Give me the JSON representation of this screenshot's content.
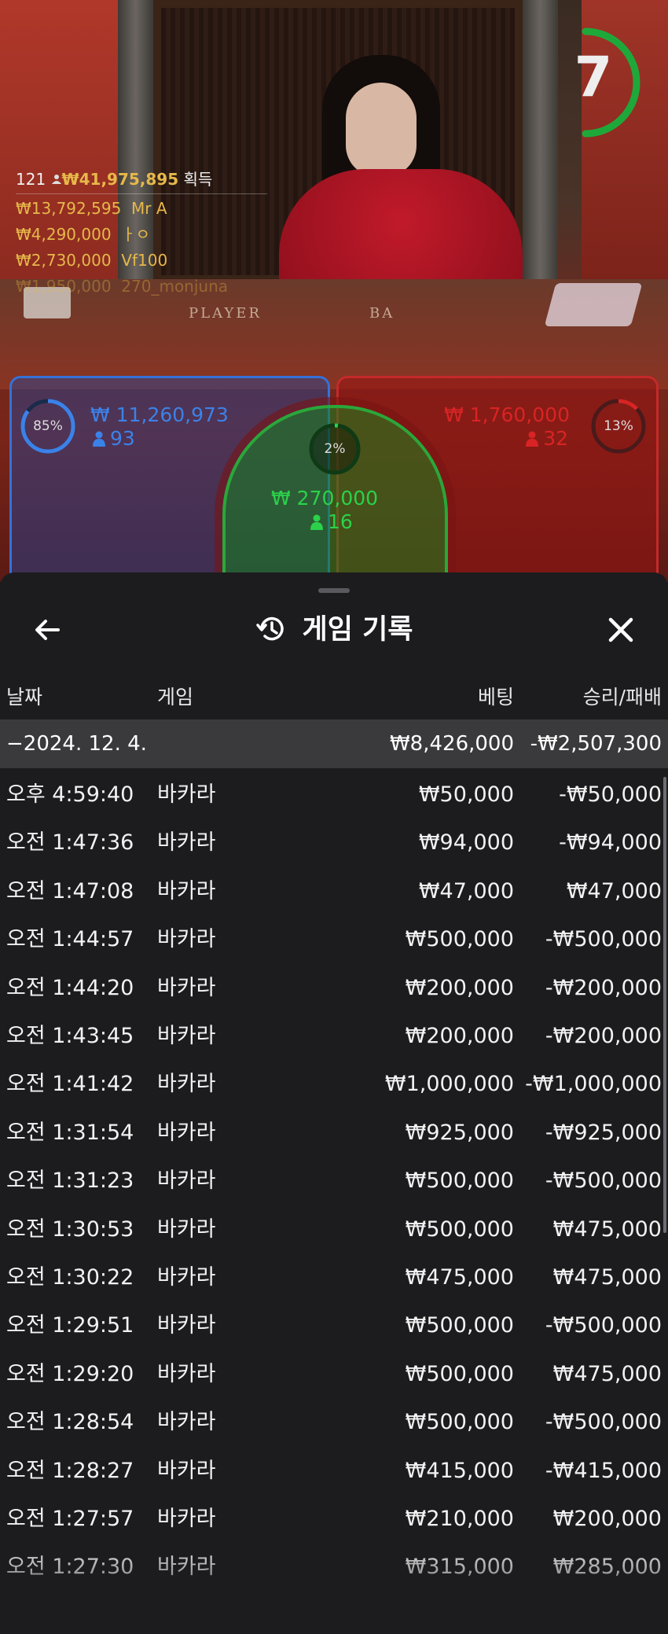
{
  "video": {
    "timer": "7",
    "table_labels": {
      "player": "PLAYER",
      "banker": "BA"
    },
    "winners": {
      "count": "121",
      "total": "₩41,975,895",
      "suffix": "획득",
      "list": [
        {
          "amount": "₩13,792,595",
          "name": "Mr A"
        },
        {
          "amount": "₩4,290,000",
          "name": "ㅏㅇ"
        },
        {
          "amount": "₩2,730,000",
          "name": "Vf100"
        },
        {
          "amount": "₩1,950,000",
          "name": "270_monjuna"
        }
      ]
    }
  },
  "bets": {
    "player": {
      "percent": "85%",
      "amount": "₩ 11,260,973",
      "count": "93"
    },
    "tie": {
      "percent": "2%",
      "amount": "₩ 270,000",
      "count": "16"
    },
    "banker": {
      "percent": "13%",
      "amount": "₩ 1,760,000",
      "count": "32"
    }
  },
  "colors": {
    "player": "#3b82e8",
    "banker": "#d82424",
    "tie": "#2bd14a",
    "timer_ring": "#1fa83a",
    "winner_gold": "#e6b84a"
  },
  "sheet": {
    "title": "게임 기록",
    "title_icon": "history-icon",
    "back_icon": "arrow-left-icon",
    "close_icon": "close-icon",
    "columns": {
      "date": "날짜",
      "game": "게임",
      "bet": "베팅",
      "result": "승리/패배"
    },
    "group": {
      "date": "−2024. 12. 4.",
      "bet": "₩8,426,000",
      "result": "-₩2,507,300"
    },
    "rows": [
      {
        "time": "오후 4:59:40",
        "game": "바카라",
        "bet": "₩50,000",
        "result": "-₩50,000"
      },
      {
        "time": "오전 1:47:36",
        "game": "바카라",
        "bet": "₩94,000",
        "result": "-₩94,000"
      },
      {
        "time": "오전 1:47:08",
        "game": "바카라",
        "bet": "₩47,000",
        "result": "₩47,000"
      },
      {
        "time": "오전 1:44:57",
        "game": "바카라",
        "bet": "₩500,000",
        "result": "-₩500,000"
      },
      {
        "time": "오전 1:44:20",
        "game": "바카라",
        "bet": "₩200,000",
        "result": "-₩200,000"
      },
      {
        "time": "오전 1:43:45",
        "game": "바카라",
        "bet": "₩200,000",
        "result": "-₩200,000"
      },
      {
        "time": "오전 1:41:42",
        "game": "바카라",
        "bet": "₩1,000,000",
        "result": "-₩1,000,000"
      },
      {
        "time": "오전 1:31:54",
        "game": "바카라",
        "bet": "₩925,000",
        "result": "-₩925,000"
      },
      {
        "time": "오전 1:31:23",
        "game": "바카라",
        "bet": "₩500,000",
        "result": "-₩500,000"
      },
      {
        "time": "오전 1:30:53",
        "game": "바카라",
        "bet": "₩500,000",
        "result": "₩475,000"
      },
      {
        "time": "오전 1:30:22",
        "game": "바카라",
        "bet": "₩475,000",
        "result": "₩475,000"
      },
      {
        "time": "오전 1:29:51",
        "game": "바카라",
        "bet": "₩500,000",
        "result": "-₩500,000"
      },
      {
        "time": "오전 1:29:20",
        "game": "바카라",
        "bet": "₩500,000",
        "result": "₩475,000"
      },
      {
        "time": "오전 1:28:54",
        "game": "바카라",
        "bet": "₩500,000",
        "result": "-₩500,000"
      },
      {
        "time": "오전 1:28:27",
        "game": "바카라",
        "bet": "₩415,000",
        "result": "-₩415,000"
      },
      {
        "time": "오전 1:27:57",
        "game": "바카라",
        "bet": "₩210,000",
        "result": "₩200,000"
      },
      {
        "time": "오전 1:27:30",
        "game": "바카라",
        "bet": "₩315,000",
        "result": "₩285,000"
      }
    ]
  }
}
